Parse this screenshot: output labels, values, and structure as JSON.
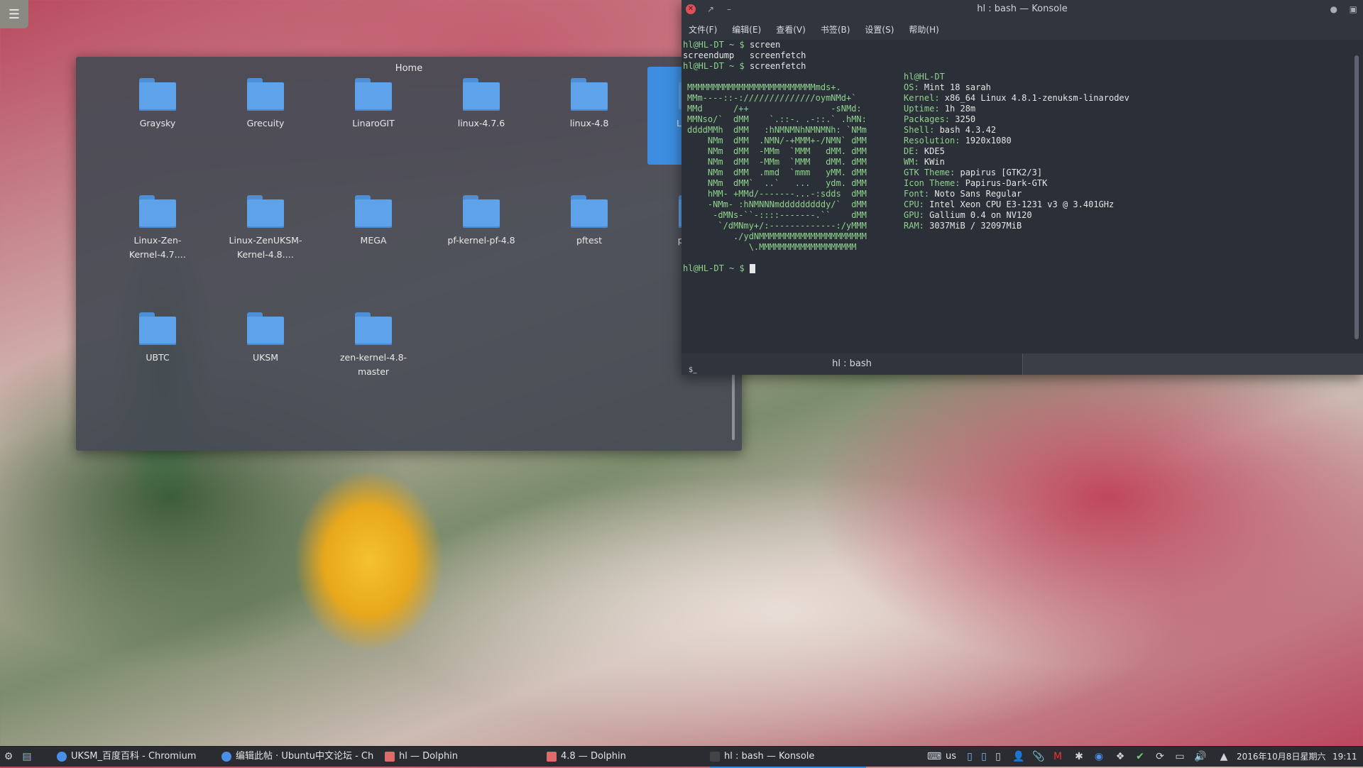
{
  "desktop": {
    "menu_icon": "hamburger-icon"
  },
  "dolphin": {
    "title": "Home",
    "files": [
      {
        "name": "Graysky"
      },
      {
        "name": "Grecuity"
      },
      {
        "name": "LinaroGIT"
      },
      {
        "name": "linux-4.7.6"
      },
      {
        "name": "linux-4.8"
      },
      {
        "name": "Linux-Firr",
        "selected": true
      },
      {
        "name": "Linux-Zen-\nKernel-4.7.…"
      },
      {
        "name": "Linux-ZenUKSM-\nKernel-4.8.…"
      },
      {
        "name": "MEGA"
      },
      {
        "name": "pf-kernel-pf-4.8"
      },
      {
        "name": "pftest"
      },
      {
        "name": "phoronix\nsuite"
      },
      {
        "name": "UBTC"
      },
      {
        "name": "UKSM"
      },
      {
        "name": "zen-kernel-4.8-\nmaster"
      }
    ]
  },
  "konsole": {
    "title": "hl : bash — Konsole",
    "menu": [
      "文件(F)",
      "编辑(E)",
      "查看(V)",
      "书签(B)",
      "设置(S)",
      "帮助(H)"
    ],
    "prompt": "hl@HL-DT ~ $",
    "cmd1": "screen",
    "completion": "screendump   screenfetch",
    "cmd2": "screenfetch",
    "logo": [
      "MMMMMMMMMMMMMMMMMMMMMMMMMmds+.",
      "MMm----::-://////////////oymNMd+`",
      "MMd      /++                -sNMd:",
      "MMNso/`  dMM    `.::-. .-::.` .hMN:",
      "ddddMMh  dMM   :hNMNMNhNMNMNh: `NMm",
      "    NMm  dMM  .NMN/-+MMM+-/NMN` dMM",
      "    NMm  dMM  -MMm  `MMM   dMM. dMM",
      "    NMm  dMM  -MMm  `MMM   dMM. dMM",
      "    NMm  dMM  .mmd  `mmm   yMM. dMM",
      "    NMm  dMM`  ..`   ...   ydm. dMM",
      "    hMM- +MMd/-------...-:sdds  dMM",
      "    -NMm- :hNMNNNmdddddddddy/`  dMM",
      "     -dMNs-``-::::-------.``    dMM",
      "      `/dMNmy+/:-------------:/yMMM",
      "         ./ydNMMMMMMMMMMMMMMMMMMMMM",
      "            \\.MMMMMMMMMMMMMMMMMMM"
    ],
    "host": "hl@HL-DT",
    "info": [
      {
        "key": "OS:",
        "value": "Mint 18 sarah"
      },
      {
        "key": "Kernel:",
        "value": "x86_64 Linux 4.8.1-zenuksm-linarodev"
      },
      {
        "key": "Uptime:",
        "value": "1h 28m"
      },
      {
        "key": "Packages:",
        "value": "3250"
      },
      {
        "key": "Shell:",
        "value": "bash 4.3.42"
      },
      {
        "key": "Resolution:",
        "value": "1920x1080"
      },
      {
        "key": "DE:",
        "value": "KDE5"
      },
      {
        "key": "WM:",
        "value": "KWin"
      },
      {
        "key": "GTK Theme:",
        "value": "papirus [GTK2/3]"
      },
      {
        "key": "Icon Theme:",
        "value": "Papirus-Dark-GTK"
      },
      {
        "key": "Font:",
        "value": "Noto Sans Regular"
      },
      {
        "key": "CPU:",
        "value": "Intel Xeon CPU E3-1231 v3 @ 3.401GHz"
      },
      {
        "key": "GPU:",
        "value": "Gallium 0.4 on NV120"
      },
      {
        "key": "RAM:",
        "value": "3037MiB / 32097MiB"
      }
    ],
    "tab_label": "hl : bash"
  },
  "taskbar": {
    "tasks": [
      {
        "label": "UKSM_百度百科 - Chromium",
        "icon": "chromium-icon"
      },
      {
        "label": "编辑此帖 · Ubuntu中文论坛 - Ch",
        "icon": "chromium-icon"
      },
      {
        "label": "hl — Dolphin",
        "icon": "dolphin-icon"
      },
      {
        "label": "4.8 — Dolphin",
        "icon": "dolphin-icon"
      },
      {
        "label": "hl : bash — Konsole",
        "icon": "konsole-icon",
        "active": true
      }
    ],
    "keyboard_layout": "us",
    "datetime": "2016年10月8日星期六",
    "time": "19:11"
  }
}
